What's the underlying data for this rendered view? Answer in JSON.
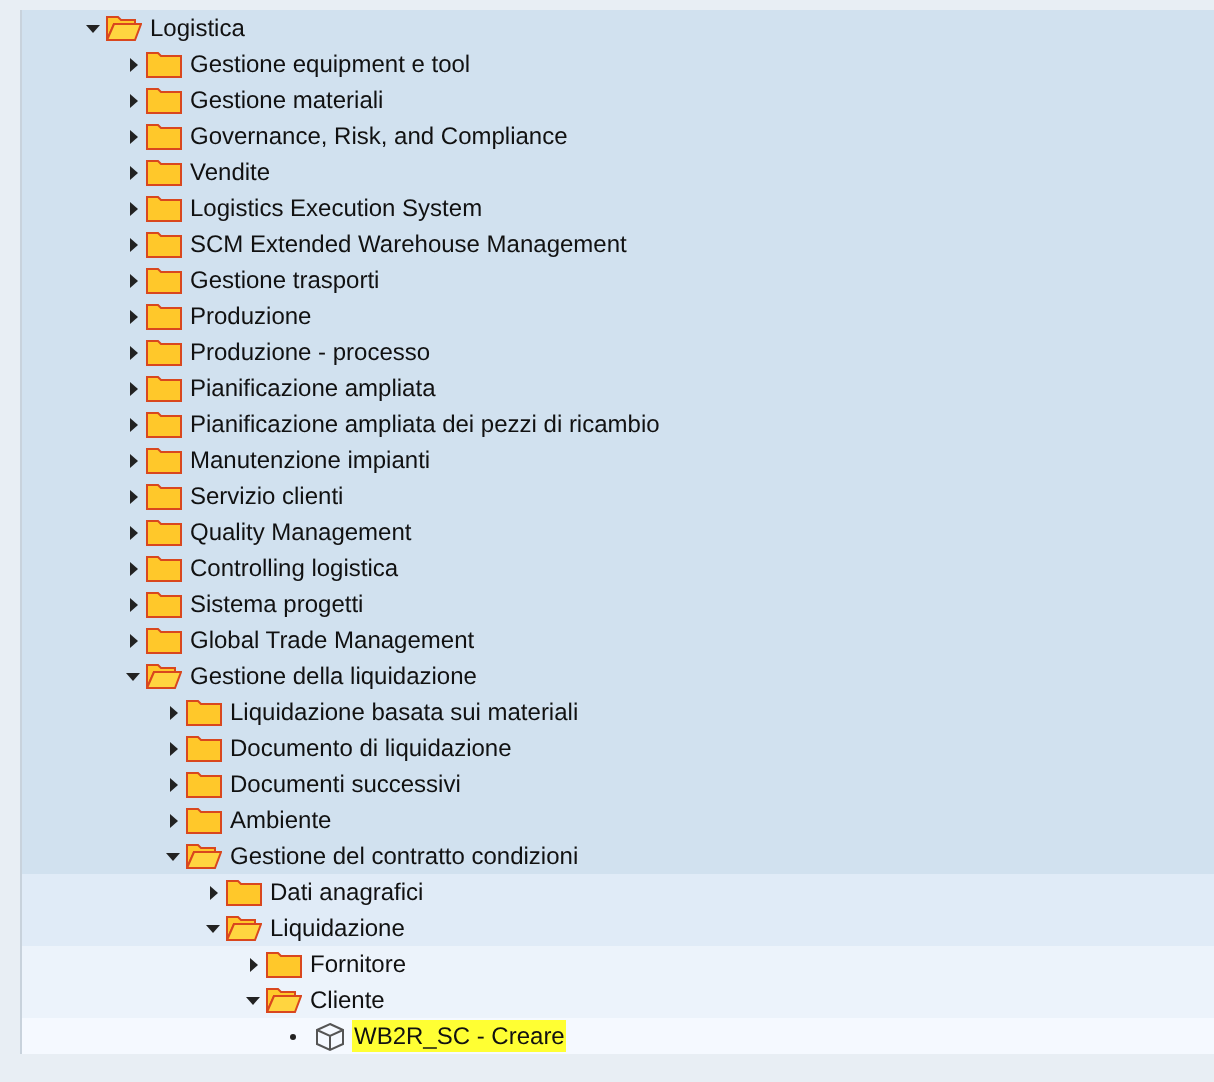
{
  "tree": [
    {
      "label": "Logistica",
      "kind": "folder",
      "expanded": true,
      "children": [
        {
          "label": "Gestione equipment e tool",
          "kind": "folder",
          "expanded": false
        },
        {
          "label": "Gestione materiali",
          "kind": "folder",
          "expanded": false
        },
        {
          "label": "Governance, Risk, and Compliance",
          "kind": "folder",
          "expanded": false
        },
        {
          "label": "Vendite",
          "kind": "folder",
          "expanded": false
        },
        {
          "label": "Logistics Execution System",
          "kind": "folder",
          "expanded": false
        },
        {
          "label": "SCM Extended Warehouse Management",
          "kind": "folder",
          "expanded": false
        },
        {
          "label": "Gestione trasporti",
          "kind": "folder",
          "expanded": false
        },
        {
          "label": "Produzione",
          "kind": "folder",
          "expanded": false
        },
        {
          "label": "Produzione - processo",
          "kind": "folder",
          "expanded": false
        },
        {
          "label": "Pianificazione ampliata",
          "kind": "folder",
          "expanded": false
        },
        {
          "label": "Pianificazione ampliata dei pezzi di ricambio",
          "kind": "folder",
          "expanded": false
        },
        {
          "label": "Manutenzione impianti",
          "kind": "folder",
          "expanded": false
        },
        {
          "label": "Servizio clienti",
          "kind": "folder",
          "expanded": false
        },
        {
          "label": "Quality Management",
          "kind": "folder",
          "expanded": false
        },
        {
          "label": "Controlling logistica",
          "kind": "folder",
          "expanded": false
        },
        {
          "label": "Sistema progetti",
          "kind": "folder",
          "expanded": false
        },
        {
          "label": "Global Trade Management",
          "kind": "folder",
          "expanded": false
        },
        {
          "label": "Gestione della liquidazione",
          "kind": "folder",
          "expanded": true,
          "children": [
            {
              "label": "Liquidazione basata sui materiali",
              "kind": "folder",
              "expanded": false
            },
            {
              "label": "Documento di liquidazione",
              "kind": "folder",
              "expanded": false
            },
            {
              "label": "Documenti successivi",
              "kind": "folder",
              "expanded": false
            },
            {
              "label": "Ambiente",
              "kind": "folder",
              "expanded": false
            },
            {
              "label": "Gestione del contratto condizioni",
              "kind": "folder",
              "expanded": true,
              "children": [
                {
                  "label": "Dati anagrafici",
                  "kind": "folder",
                  "expanded": false
                },
                {
                  "label": "Liquidazione",
                  "kind": "folder",
                  "expanded": true,
                  "children": [
                    {
                      "label": "Fornitore",
                      "kind": "folder",
                      "expanded": false
                    },
                    {
                      "label": "Cliente",
                      "kind": "folder",
                      "expanded": true,
                      "children": [
                        {
                          "label": "WB2R_SC - Creare",
                          "kind": "transaction",
                          "selected": true
                        }
                      ]
                    }
                  ]
                }
              ]
            }
          ]
        }
      ]
    }
  ]
}
